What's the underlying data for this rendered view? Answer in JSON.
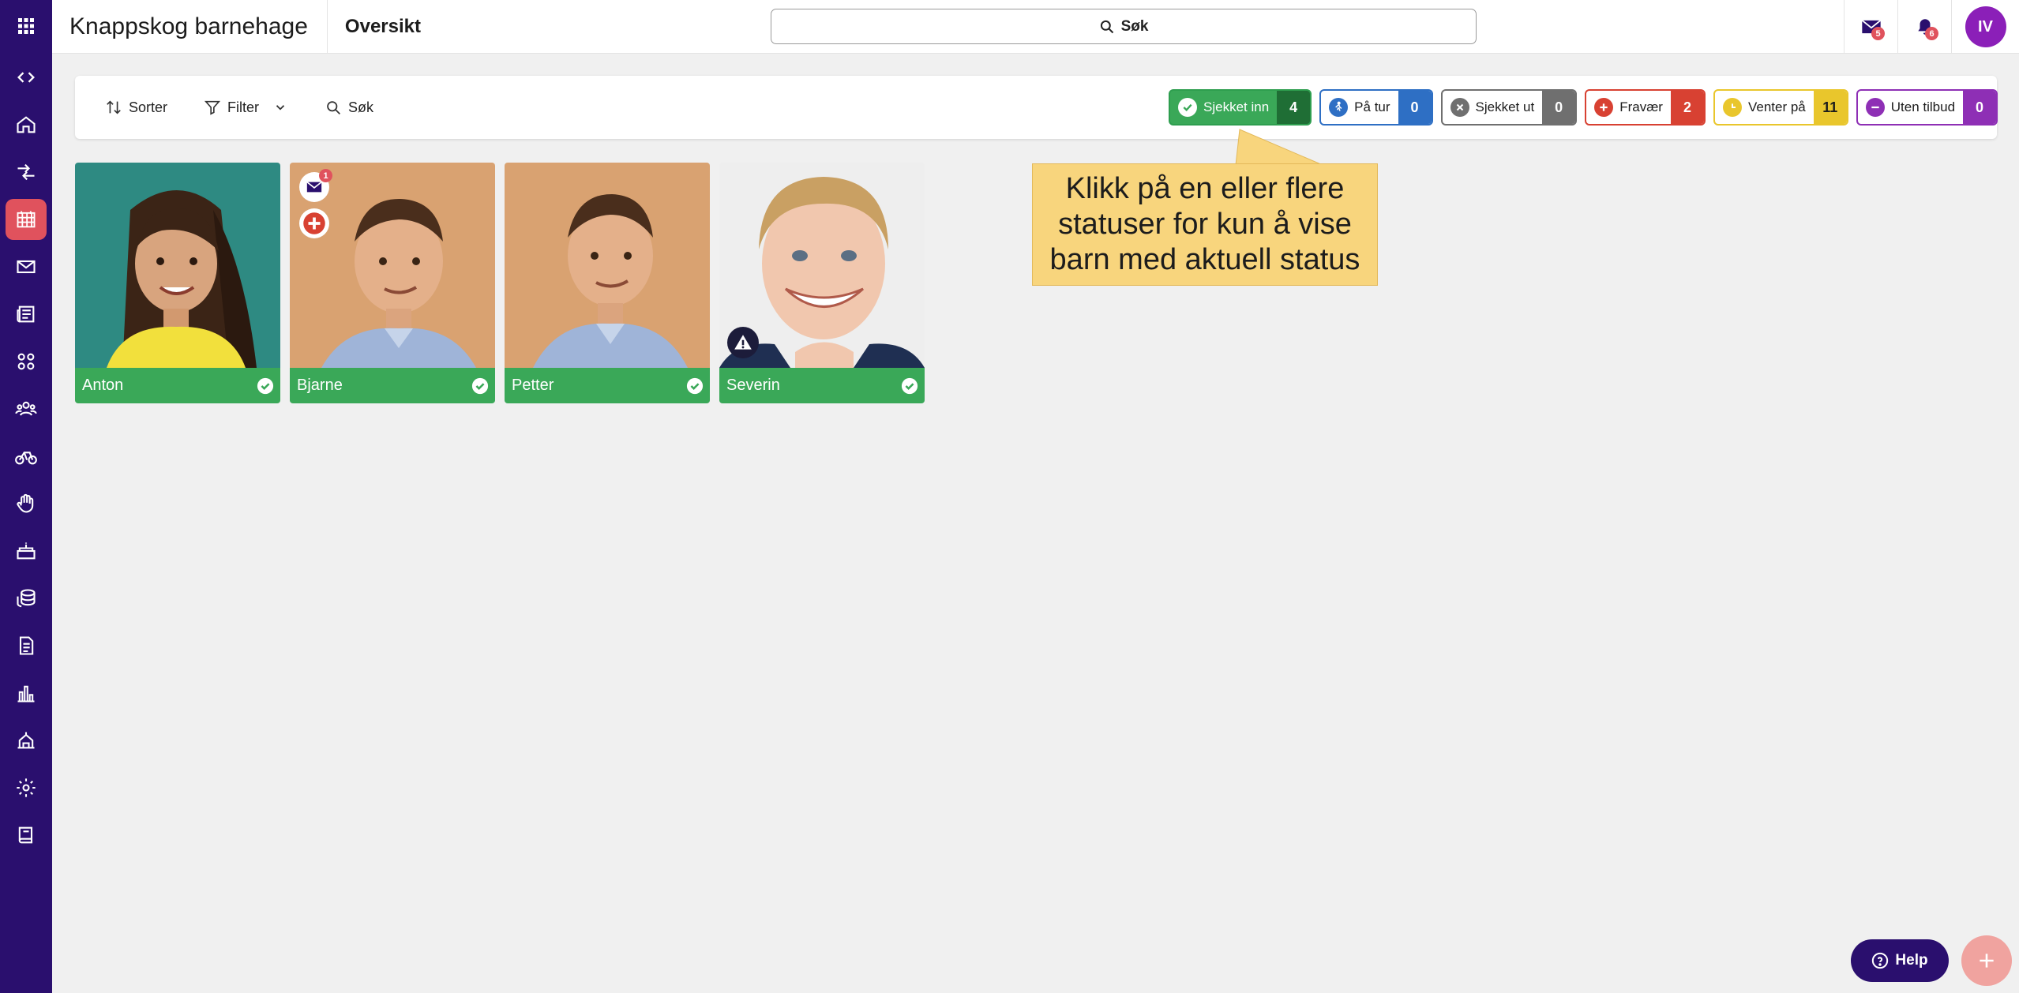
{
  "header": {
    "org_name": "Knappskog barnehage",
    "page_title": "Oversikt",
    "search_label": "Søk",
    "messages_count": "5",
    "notifications_count": "6",
    "user_initials": "IV"
  },
  "sidebar": {
    "items": [
      {
        "icon": "code-toggle-icon"
      },
      {
        "icon": "home-icon"
      },
      {
        "icon": "swap-icon"
      },
      {
        "icon": "calendar-grid-icon",
        "active": true
      },
      {
        "icon": "mail-icon"
      },
      {
        "icon": "newspaper-icon"
      },
      {
        "icon": "groups-icon"
      },
      {
        "icon": "people-icon"
      },
      {
        "icon": "bicycle-icon"
      },
      {
        "icon": "hand-icon"
      },
      {
        "icon": "cake-icon"
      },
      {
        "icon": "coins-icon"
      },
      {
        "icon": "document-icon"
      },
      {
        "icon": "bar-chart-icon"
      },
      {
        "icon": "building-icon"
      },
      {
        "icon": "gear-icon"
      },
      {
        "icon": "book-icon"
      }
    ]
  },
  "toolbar": {
    "sort_label": "Sorter",
    "filter_label": "Filter",
    "search_label": "Søk"
  },
  "statuses": [
    {
      "key": "in",
      "label": "Sjekket inn",
      "count": "4",
      "color": "#3aa858"
    },
    {
      "key": "tur",
      "label": "På tur",
      "count": "0",
      "color": "#2e6fc4"
    },
    {
      "key": "ut",
      "label": "Sjekket ut",
      "count": "0",
      "color": "#6f6f6f"
    },
    {
      "key": "fr",
      "label": "Fravær",
      "count": "2",
      "color": "#d84132"
    },
    {
      "key": "ve",
      "label": "Venter på",
      "count": "11",
      "color": "#e9c62c"
    },
    {
      "key": "ub",
      "label": "Uten tilbud",
      "count": "0",
      "color": "#8e2fb5"
    }
  ],
  "children": [
    {
      "name": "Anton",
      "status": "checked-in"
    },
    {
      "name": "Bjarne",
      "status": "checked-in",
      "unread_messages": "1",
      "has_absence_action": true
    },
    {
      "name": "Petter",
      "status": "checked-in"
    },
    {
      "name": "Severin",
      "status": "checked-in",
      "has_warning": true
    }
  ],
  "tooltip": {
    "text": "Klikk på en eller flere statuser for kun å vise barn med aktuell status"
  },
  "help_label": "Help"
}
